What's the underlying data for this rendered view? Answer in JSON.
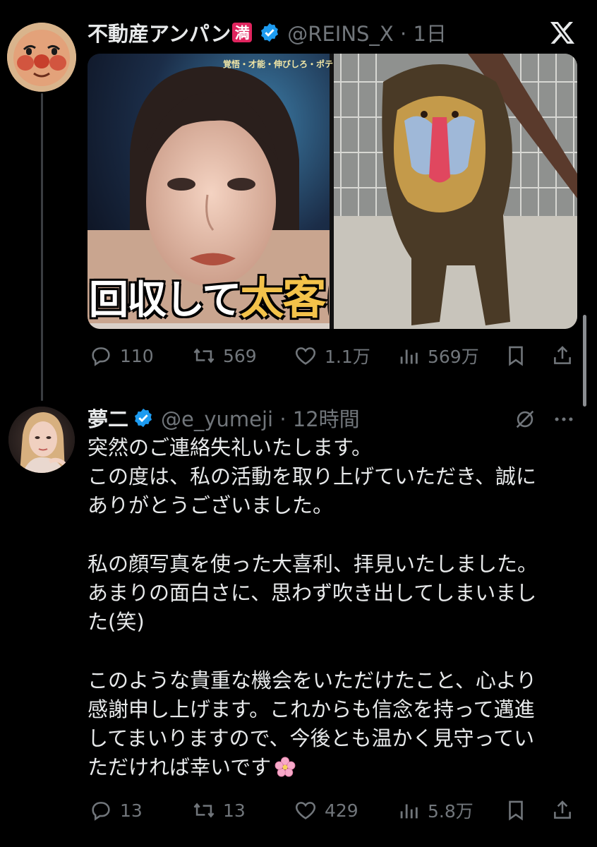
{
  "tweet": {
    "author_name": "不動産アンパン",
    "author_badge": "満",
    "handle_time": "@REINS_X · 1日",
    "media_caption_main": "回収して",
    "media_caption_accent": "太客にし",
    "media_top_caption": "覚悟・才能・伸びしろ・ポテ",
    "actions": {
      "replies": "110",
      "retweets": "569",
      "likes": "1.1万",
      "views": "569万"
    }
  },
  "reply": {
    "author_name": "夢二",
    "handle_time": "@e_yumeji · 12時間",
    "paragraphs": [
      [
        "突然のご連絡失礼いたします。",
        "この度は、私の活動を取り上げていただき、誠に",
        "ありがとうございました。"
      ],
      [
        "私の顔写真を使った大喜利、拝見いたしました。",
        "あまりの面白さに、思わず吹き出してしまいまし",
        "た(笑)"
      ],
      [
        "このような貴重な機会をいただけたこと、心より",
        "感謝申し上げます。これからも信念を持って邁進",
        "してまいりますので、今後とも温かく見守ってい",
        "ただければ幸いです"
      ]
    ],
    "actions": {
      "replies": "13",
      "retweets": "13",
      "likes": "429",
      "views": "5.8万"
    }
  },
  "colors": {
    "background": "#000000",
    "text": "#e7e9ea",
    "muted": "#71767b",
    "verified": "#1d9bf0",
    "badge": "#e0245e"
  },
  "icons": [
    "x-logo-icon",
    "verified-icon",
    "reply-icon",
    "retweet-icon",
    "like-icon",
    "views-icon",
    "bookmark-icon",
    "share-icon",
    "grok-icon",
    "more-icon",
    "cherry-blossom-icon"
  ]
}
